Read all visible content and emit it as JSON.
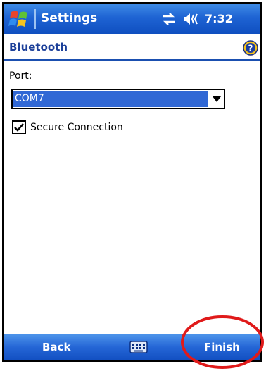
{
  "titlebar": {
    "app_title": "Settings",
    "clock": "7:32"
  },
  "header": {
    "title": "Bluetooth"
  },
  "form": {
    "port_label": "Port:",
    "port_value": "COM7",
    "secure_label": "Secure Connection",
    "secure_checked": true
  },
  "menubar": {
    "left_label": "Back",
    "right_label": "Finish"
  },
  "colors": {
    "titlebar": "#1e63d3",
    "selection": "#3168d5",
    "header_text": "#1b3f99",
    "annotation": "#e01a1a"
  },
  "icons": {
    "start": "windows-flag-icon",
    "connectivity": "connectivity-icon",
    "volume": "speaker-icon",
    "help": "help-icon",
    "keyboard": "keyboard-icon"
  }
}
